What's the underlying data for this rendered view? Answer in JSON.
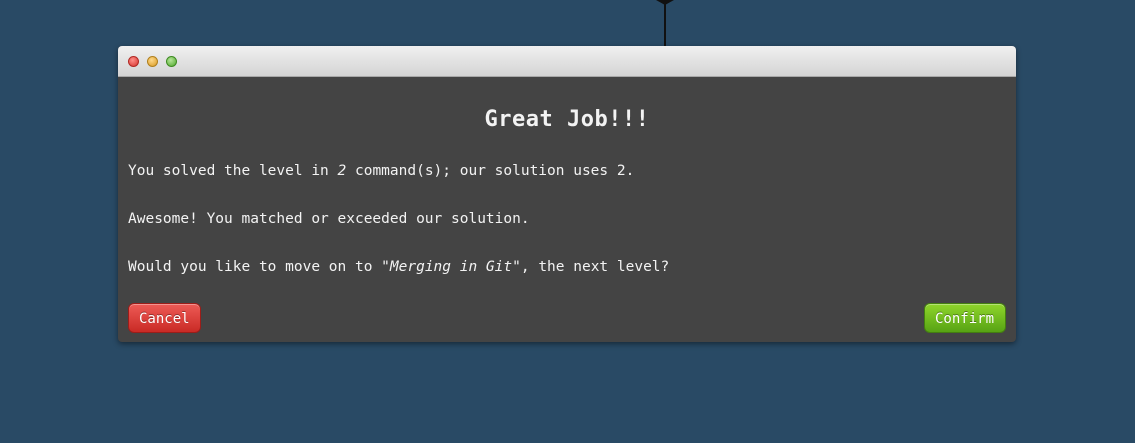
{
  "dialog": {
    "title": "Great Job!!!",
    "line1": {
      "prefix": "You solved the level in ",
      "count": "2",
      "suffix": " command(s); our solution uses 2."
    },
    "line2": "Awesome! You matched or exceeded our solution.",
    "line3": {
      "prefix": "Would you like to move on to ",
      "level_name": "\"Merging in Git\"",
      "suffix": ", the next level?"
    },
    "buttons": {
      "cancel": "Cancel",
      "confirm": "Confirm"
    }
  },
  "colors": {
    "background": "#294a65",
    "dialog_body": "#444444",
    "cancel_button": "#d9322d",
    "confirm_button": "#6ab81c"
  },
  "icons": {
    "traffic_lights": [
      "close-light",
      "minimize-light",
      "maximize-light"
    ],
    "branch_arrow": "arrow-up-icon"
  }
}
